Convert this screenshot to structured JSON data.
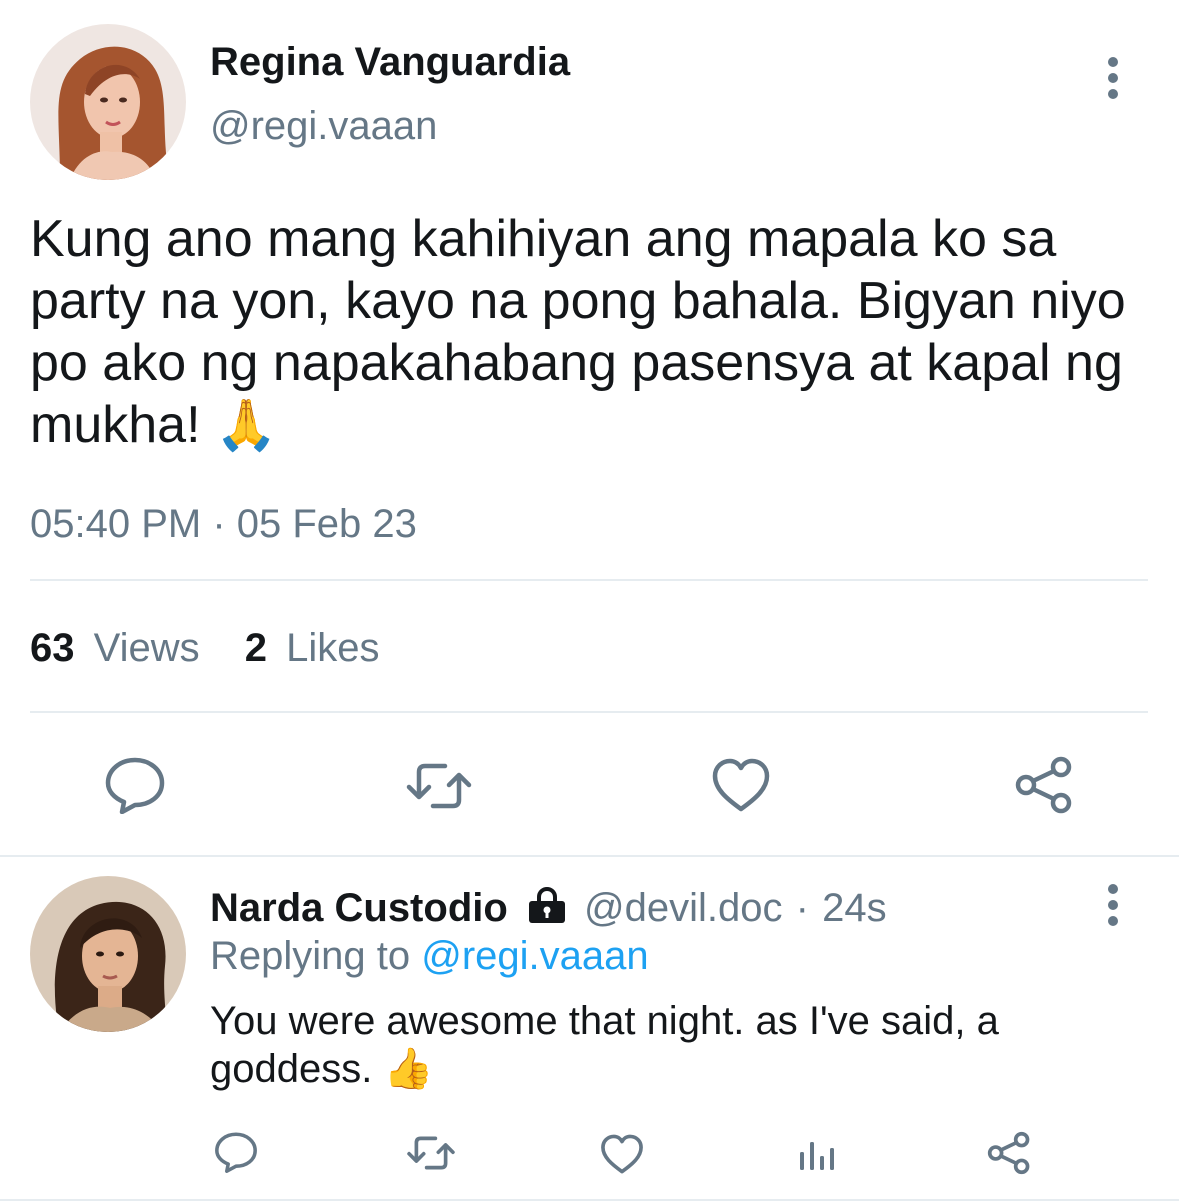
{
  "main_tweet": {
    "author_name": "Regina Vanguardia",
    "handle": "@regi.vaaan",
    "text_lines": [
      "Kung ano mang kahihiyan ang mapala ko sa",
      "party na yon, kayo na pong bahala. Bigyan niyo",
      "po ako ng napakahabang pasensya at kapal ng",
      "mukha! "
    ],
    "emoji": "🙏",
    "timestamp": "05:40 PM · 05 Feb 23",
    "stats": {
      "views_count": "63",
      "views_label": "Views",
      "likes_count": "2",
      "likes_label": "Likes"
    },
    "actions": [
      "reply-icon",
      "retweet-icon",
      "like-icon",
      "share-icon"
    ]
  },
  "reply_tweet": {
    "author_name": "Narda Custodio",
    "handle": "@devil.doc",
    "time": "24s",
    "separator": "·",
    "replying_to_label": "Replying to",
    "replying_to_handle": "@regi.vaaan",
    "text_lines": [
      "You were awesome that night. as I've said, a",
      "goddess. "
    ],
    "emoji": "👍",
    "actions": [
      "reply-icon",
      "retweet-icon",
      "like-icon",
      "analytics-icon",
      "share-icon"
    ]
  },
  "colors": {
    "text_primary": "#14171a",
    "text_secondary": "#657786",
    "link": "#1da1f2",
    "divider": "#e6ecf0"
  }
}
